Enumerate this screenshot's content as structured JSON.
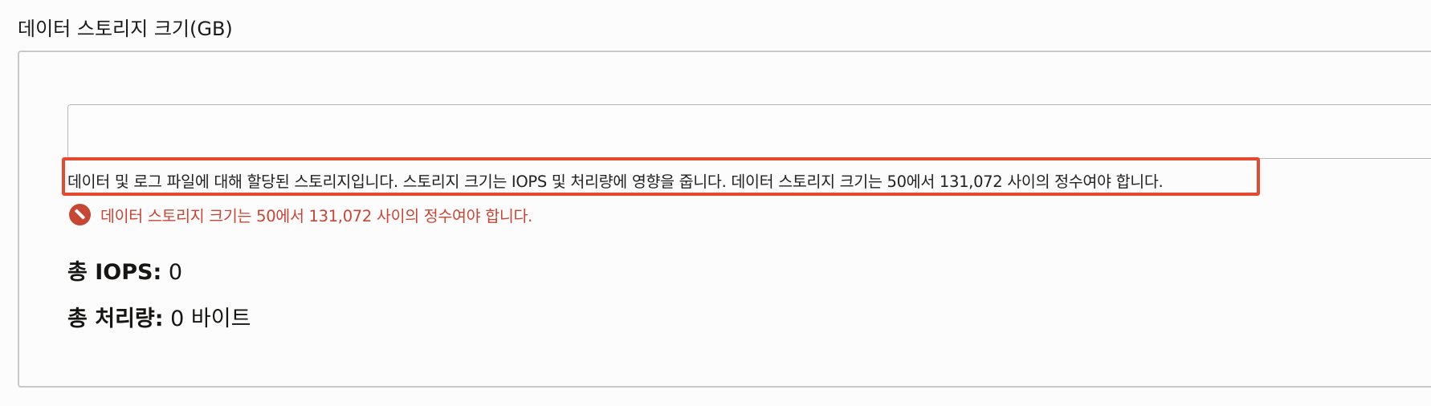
{
  "field": {
    "label": "데이터 스토리지 크기(GB)",
    "value": "",
    "placeholder": ""
  },
  "help": {
    "text": "데이터 및 로그 파일에 대해 할당된 스토리지입니다. 스토리지 크기는 IOPS 및 처리량에 영향을 줍니다. 데이터 스토리지 크기는 50에서 131,072 사이의 정수여야 합니다.",
    "highlight_color": "#e64a2e"
  },
  "error": {
    "icon": "error-icon",
    "text": "데이터 스토리지 크기는 50에서 131,072 사이의 정수여야 합니다.",
    "color": "#c74634"
  },
  "stats": {
    "iops": {
      "label": "총 IOPS:",
      "value": "0"
    },
    "throughput": {
      "label": "총 처리량:",
      "value": "0 바이트"
    }
  }
}
